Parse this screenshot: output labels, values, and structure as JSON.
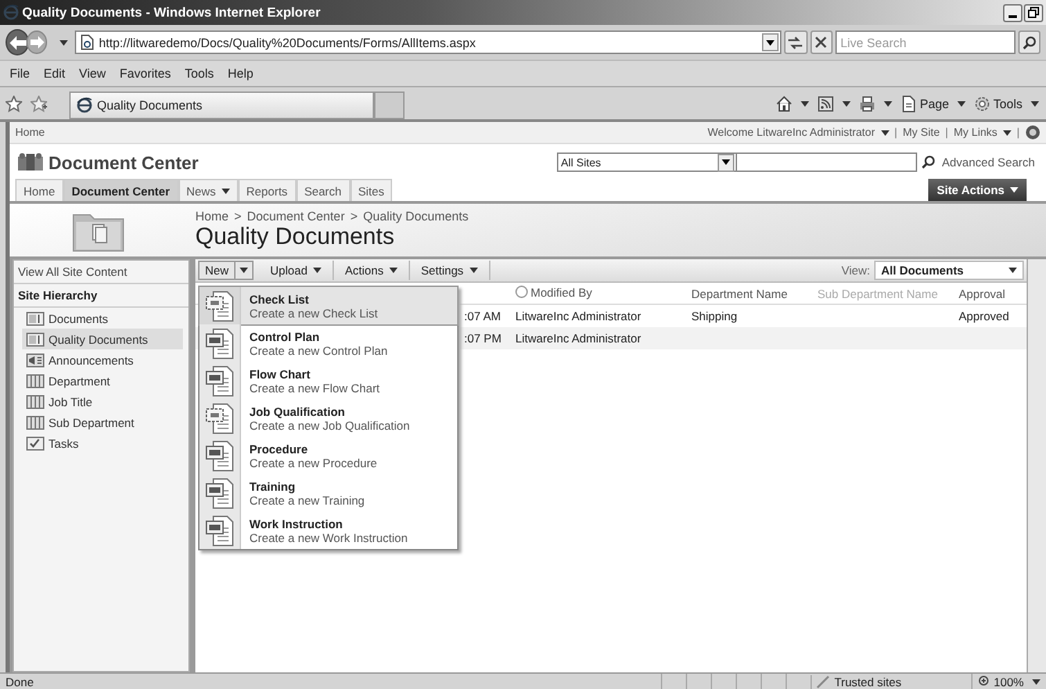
{
  "window": {
    "title": "Quality Documents - Windows Internet Explorer"
  },
  "address_bar": {
    "url": "http://litwaredemo/Docs/Quality%20Documents/Forms/AllItems.aspx",
    "search_placeholder": "Live Search"
  },
  "menu_bar": [
    "File",
    "Edit",
    "View",
    "Favorites",
    "Tools",
    "Help"
  ],
  "browser_tabs": [
    {
      "label": "Quality Documents",
      "selected": true
    }
  ],
  "command_bar": [
    {
      "kind": "home"
    },
    {
      "kind": "feeds"
    },
    {
      "kind": "print"
    },
    {
      "kind": "page",
      "label": "Page"
    },
    {
      "kind": "tools",
      "label": "Tools"
    }
  ],
  "top_links": {
    "home": "Home",
    "welcome": "Welcome LitwareInc Administrator",
    "links": [
      "My Site",
      "My Links"
    ],
    "separator": "|"
  },
  "site": {
    "title": "Document Center",
    "search_scope": "All Sites",
    "advanced_search": "Advanced Search",
    "site_actions": "Site Actions"
  },
  "top_nav": [
    {
      "label": "Home",
      "selected": false,
      "has_menu": false
    },
    {
      "label": "Document Center",
      "selected": true,
      "has_menu": false
    },
    {
      "label": "News",
      "selected": false,
      "has_menu": true
    },
    {
      "label": "Reports",
      "selected": false,
      "has_menu": false
    },
    {
      "label": "Search",
      "selected": false,
      "has_menu": false
    },
    {
      "label": "Sites",
      "selected": false,
      "has_menu": false
    }
  ],
  "breadcrumb": {
    "items": [
      "Home",
      "Document Center",
      "Quality Documents"
    ],
    "separator": ">"
  },
  "page_title": "Quality Documents",
  "sidebar": {
    "view_all": "View All Site Content",
    "heading": "Site Hierarchy",
    "items": [
      {
        "label": "Documents",
        "kind": "library",
        "selected": false
      },
      {
        "label": "Quality Documents",
        "kind": "library",
        "selected": true
      },
      {
        "label": "Announcements",
        "kind": "announcements",
        "selected": false
      },
      {
        "label": "Department",
        "kind": "list",
        "selected": false
      },
      {
        "label": "Job Title",
        "kind": "list",
        "selected": false
      },
      {
        "label": "Sub Department",
        "kind": "list",
        "selected": false
      },
      {
        "label": "Tasks",
        "kind": "tasks",
        "selected": false
      }
    ]
  },
  "toolbar": {
    "buttons": [
      "New",
      "Upload",
      "Actions",
      "Settings"
    ],
    "view_label": "View:",
    "view_value": "All Documents"
  },
  "table": {
    "columns": [
      {
        "label": "Modified By",
        "dim": false
      },
      {
        "label": "Department Name",
        "dim": false
      },
      {
        "label": "Sub Department Name",
        "dim": true
      },
      {
        "label": "Approval",
        "dim": false
      }
    ],
    "rows": [
      {
        "partly_hidden": ":07 AM",
        "cells": [
          "LitwareInc Administrator",
          "Shipping",
          "",
          "Approved"
        ]
      },
      {
        "partly_hidden": ":07 PM",
        "cells": [
          "LitwareInc Administrator",
          "",
          "",
          ""
        ]
      }
    ]
  },
  "new_menu": [
    {
      "title": "Check List",
      "description": "Create a new Check List",
      "kind": "form",
      "selected": true
    },
    {
      "title": "Control Plan",
      "description": "Create a new Control Plan",
      "kind": "word",
      "selected": false
    },
    {
      "title": "Flow Chart",
      "description": "Create a new Flow Chart",
      "kind": "word",
      "selected": false
    },
    {
      "title": "Job Qualification",
      "description": "Create a new Job Qualification",
      "kind": "form",
      "selected": false
    },
    {
      "title": "Procedure",
      "description": "Create a new Procedure",
      "kind": "word",
      "selected": false
    },
    {
      "title": "Training",
      "description": "Create a new Training",
      "kind": "word",
      "selected": false
    },
    {
      "title": "Work Instruction",
      "description": "Create a new Work Instruction",
      "kind": "word",
      "selected": false
    }
  ],
  "status_bar": {
    "text": "Done",
    "zone": "Trusted sites",
    "zoom": "100%"
  }
}
